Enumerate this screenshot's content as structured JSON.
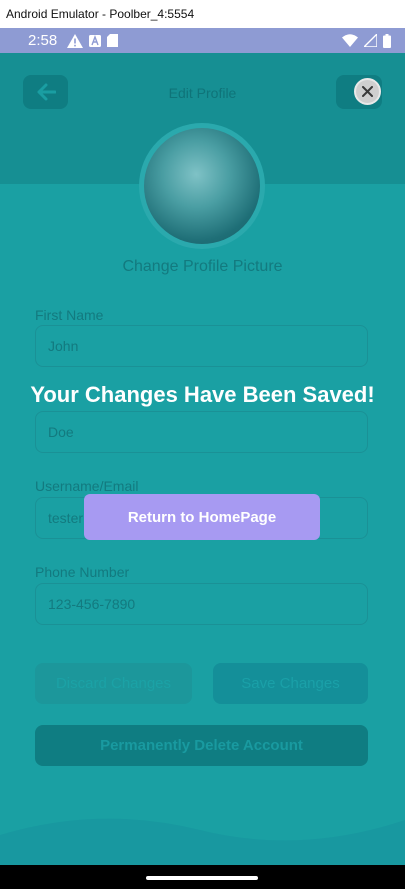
{
  "window": {
    "title": "Android Emulator - Poolber_4:5554"
  },
  "status_bar": {
    "time": "2:58",
    "icons_left": [
      "warning-icon",
      "a-icon",
      "sd-card-icon"
    ],
    "icons_right": [
      "wifi-icon",
      "signal-icon",
      "battery-icon"
    ]
  },
  "header": {
    "title": "Edit Profile"
  },
  "profile": {
    "change_picture_label": "Change Profile Picture"
  },
  "form": {
    "first_name": {
      "label": "First Name",
      "value": "John"
    },
    "last_name": {
      "value": "Doe"
    },
    "username": {
      "label": "Username/Email",
      "value": "tester"
    },
    "phone": {
      "label": "Phone Number",
      "value": "123-456-7890"
    }
  },
  "actions": {
    "discard_label": "Discard Changes",
    "save_label": "Save Changes",
    "delete_label": "Permanently Delete Account"
  },
  "dialog": {
    "message": "Your Changes Have Been Saved!",
    "return_label": "Return to HomePage"
  },
  "colors": {
    "overlay_teal": "#1aa0a3",
    "status_bar": "#8e9bd3",
    "return_button": "#a79af2"
  }
}
